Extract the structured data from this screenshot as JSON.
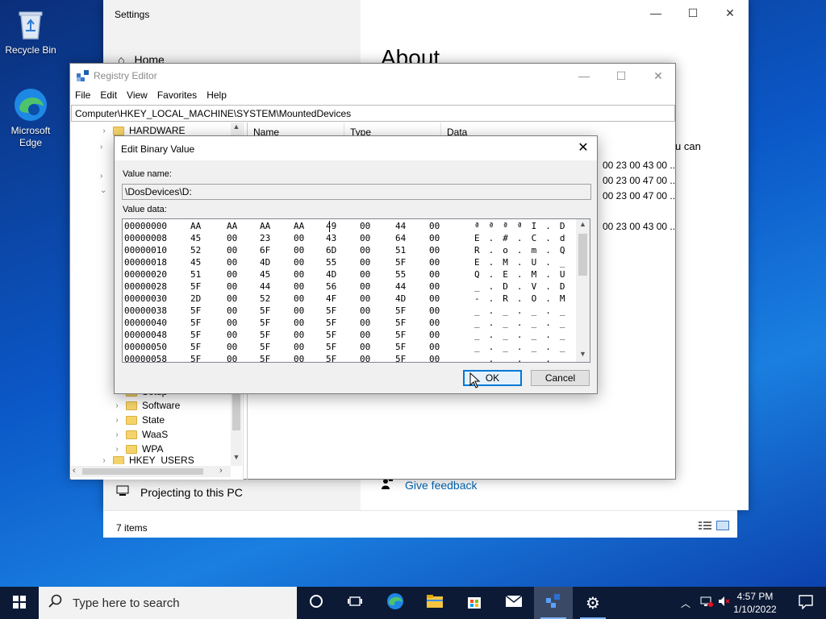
{
  "desktop": {
    "icons": [
      {
        "label": "Recycle Bin"
      },
      {
        "label": "Microsoft Edge"
      }
    ]
  },
  "settings": {
    "title": "Settings",
    "home_label": "Home",
    "heading": "About",
    "partial_text": "u can",
    "projecting_label": "Projecting to this PC",
    "feedback_label": "Give feedback"
  },
  "explorer": {
    "item_count": "7 items"
  },
  "regedit": {
    "title": "Registry Editor",
    "menu": [
      "File",
      "Edit",
      "View",
      "Favorites",
      "Help"
    ],
    "address": "Computer\\HKEY_LOCAL_MACHINE\\SYSTEM\\MountedDevices",
    "columns": {
      "name": "Name",
      "type": "Type",
      "data": "Data"
    },
    "data_values": [
      "00 23 00 43 00 ...",
      "00 23 00 47 00 ...",
      "00 23 00 47 00 ...",
      "00 23 00 43 00 ..."
    ],
    "tree": {
      "hardware": "HARDWARE",
      "partial_top": "Setup",
      "software": "Software",
      "state": "State",
      "waas": "WaaS",
      "wpa": "WPA",
      "hkey_users": "HKEY_USERS"
    }
  },
  "dialog": {
    "title": "Edit Binary Value",
    "value_name_label": "Value name:",
    "value_name": "\\DosDevices\\D:",
    "value_data_label": "Value data:",
    "ok_label": "OK",
    "cancel_label": "Cancel",
    "rows": [
      {
        "addr": "00000000",
        "bytes": [
          "AA",
          "AA",
          "AA",
          "AA",
          "49",
          "00",
          "44",
          "00"
        ],
        "ascii": "ª ª ª ª I . D ."
      },
      {
        "addr": "00000008",
        "bytes": [
          "45",
          "00",
          "23",
          "00",
          "43",
          "00",
          "64",
          "00"
        ],
        "ascii": "E . # . C . d ."
      },
      {
        "addr": "00000010",
        "bytes": [
          "52",
          "00",
          "6F",
          "00",
          "6D",
          "00",
          "51",
          "00"
        ],
        "ascii": "R . o . m . Q ."
      },
      {
        "addr": "00000018",
        "bytes": [
          "45",
          "00",
          "4D",
          "00",
          "55",
          "00",
          "5F",
          "00"
        ],
        "ascii": "E . M . U . _ ."
      },
      {
        "addr": "00000020",
        "bytes": [
          "51",
          "00",
          "45",
          "00",
          "4D",
          "00",
          "55",
          "00"
        ],
        "ascii": "Q . E . M . U ."
      },
      {
        "addr": "00000028",
        "bytes": [
          "5F",
          "00",
          "44",
          "00",
          "56",
          "00",
          "44",
          "00"
        ],
        "ascii": "_ . D . V . D ."
      },
      {
        "addr": "00000030",
        "bytes": [
          "2D",
          "00",
          "52",
          "00",
          "4F",
          "00",
          "4D",
          "00"
        ],
        "ascii": "- . R . O . M ."
      },
      {
        "addr": "00000038",
        "bytes": [
          "5F",
          "00",
          "5F",
          "00",
          "5F",
          "00",
          "5F",
          "00"
        ],
        "ascii": "_ . _ . _ . _ ."
      },
      {
        "addr": "00000040",
        "bytes": [
          "5F",
          "00",
          "5F",
          "00",
          "5F",
          "00",
          "5F",
          "00"
        ],
        "ascii": "_ . _ . _ . _ ."
      },
      {
        "addr": "00000048",
        "bytes": [
          "5F",
          "00",
          "5F",
          "00",
          "5F",
          "00",
          "5F",
          "00"
        ],
        "ascii": "_ . _ . _ . _ ."
      },
      {
        "addr": "00000050",
        "bytes": [
          "5F",
          "00",
          "5F",
          "00",
          "5F",
          "00",
          "5F",
          "00"
        ],
        "ascii": "_ . _ . _ . _ ."
      },
      {
        "addr": "00000058",
        "bytes": [
          "5F",
          "00",
          "5F",
          "00",
          "5F",
          "00",
          "5F",
          "00"
        ],
        "ascii": "_ . _ . _ . _ ."
      }
    ]
  },
  "taskbar": {
    "search_placeholder": "Type here to search",
    "time": "4:57 PM",
    "date": "1/10/2022"
  }
}
